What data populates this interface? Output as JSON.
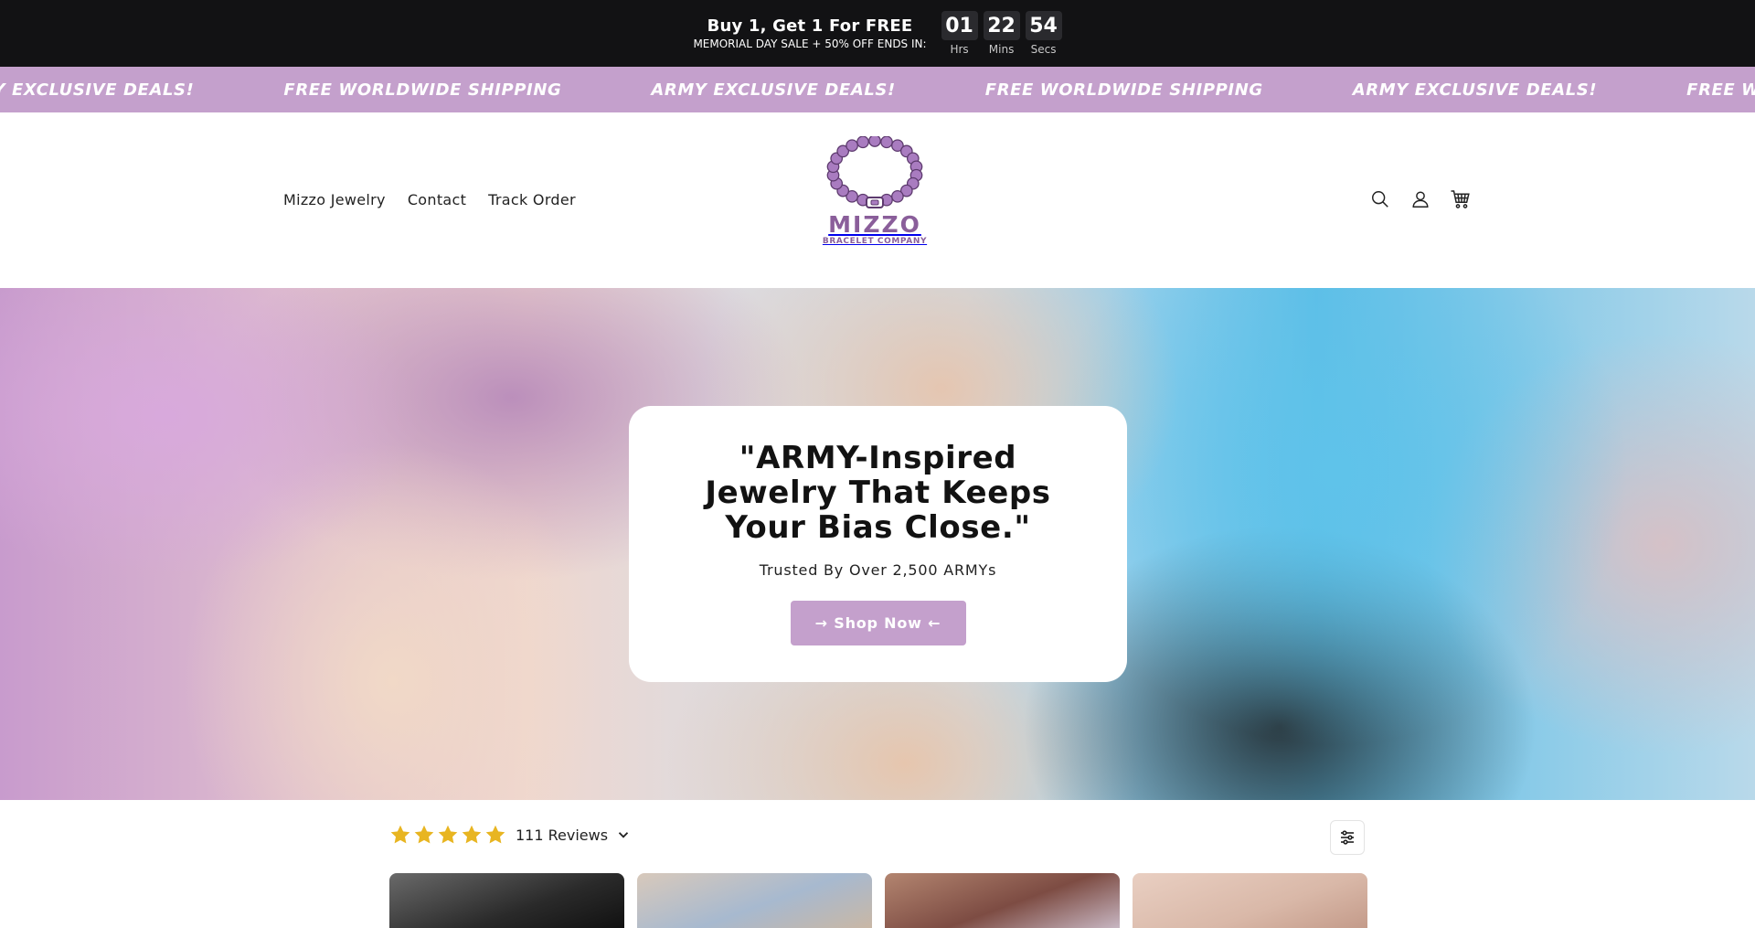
{
  "announcement": {
    "title": "Buy 1, Get 1 For FREE",
    "subtitle": "MEMORIAL DAY SALE + 50% OFF ENDS IN:",
    "countdown": [
      {
        "value": "01",
        "label": "Hrs"
      },
      {
        "value": "22",
        "label": "Mins"
      },
      {
        "value": "54",
        "label": "Secs"
      }
    ]
  },
  "marquee": {
    "items": [
      "ARMY EXCLUSIVE DEALS!",
      "FREE WORLDWIDE SHIPPING",
      "ARMY EXCLUSIVE DEALS!",
      "FREE WORLDWIDE SHIPPING",
      "ARMY EXCLUSIVE DEALS!",
      "FREE WORLDWIDE SHIPPING"
    ],
    "background": "#c4a0cc"
  },
  "header": {
    "nav": [
      "Mizzo Jewelry",
      "Contact",
      "Track Order"
    ],
    "logo": {
      "name": "MIZZO",
      "tagline": "BRACELET COMPANY",
      "color": "#8a5e9a",
      "bead_color": "#a97cc0"
    },
    "icons": [
      "search-icon",
      "account-icon",
      "cart-icon"
    ]
  },
  "hero": {
    "title": "\"ARMY-Inspired Jewelry That Keeps Your Bias Close.\"",
    "subtitle": "Trusted By Over 2,500 ARMYs",
    "button": "→ Shop Now ←",
    "button_color": "#c4a0cc"
  },
  "reviews": {
    "rating_stars": 5,
    "count_label": "111 Reviews",
    "star_color": "#e8b521",
    "thumb_colors": [
      "#3b3b3b",
      "#c9b7a5",
      "#7d4c43",
      "#d9b8a8"
    ]
  },
  "colors": {
    "topbar": "#121214",
    "accent": "#c4a0cc"
  }
}
